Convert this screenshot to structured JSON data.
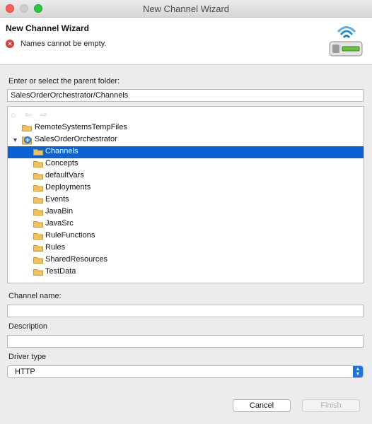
{
  "window": {
    "title": "New Channel Wizard"
  },
  "banner": {
    "title": "New Channel Wizard",
    "error_message": "Names cannot be empty."
  },
  "parent_folder": {
    "label": "Enter or select the parent folder:",
    "value": "SalesOrderOrchestrator/Channels"
  },
  "tree": {
    "items": [
      {
        "label": "RemoteSystemsTempFiles"
      },
      {
        "label": "SalesOrderOrchestrator"
      },
      {
        "label": "Channels",
        "selected": true
      },
      {
        "label": "Concepts"
      },
      {
        "label": "defaultVars"
      },
      {
        "label": "Deployments"
      },
      {
        "label": "Events"
      },
      {
        "label": "JavaBin"
      },
      {
        "label": "JavaSrc"
      },
      {
        "label": "RuleFunctions"
      },
      {
        "label": "Rules"
      },
      {
        "label": "SharedResources"
      },
      {
        "label": "TestData"
      }
    ]
  },
  "channel_name": {
    "label": "Channel name:",
    "value": ""
  },
  "description": {
    "label": "Description",
    "value": ""
  },
  "driver_type": {
    "label": "Driver type",
    "selected": "HTTP"
  },
  "buttons": {
    "cancel": "Cancel",
    "finish": "Finish"
  },
  "colors": {
    "selection": "#0a63d6",
    "error": "#d6403a",
    "accent": "#1a72e8"
  }
}
